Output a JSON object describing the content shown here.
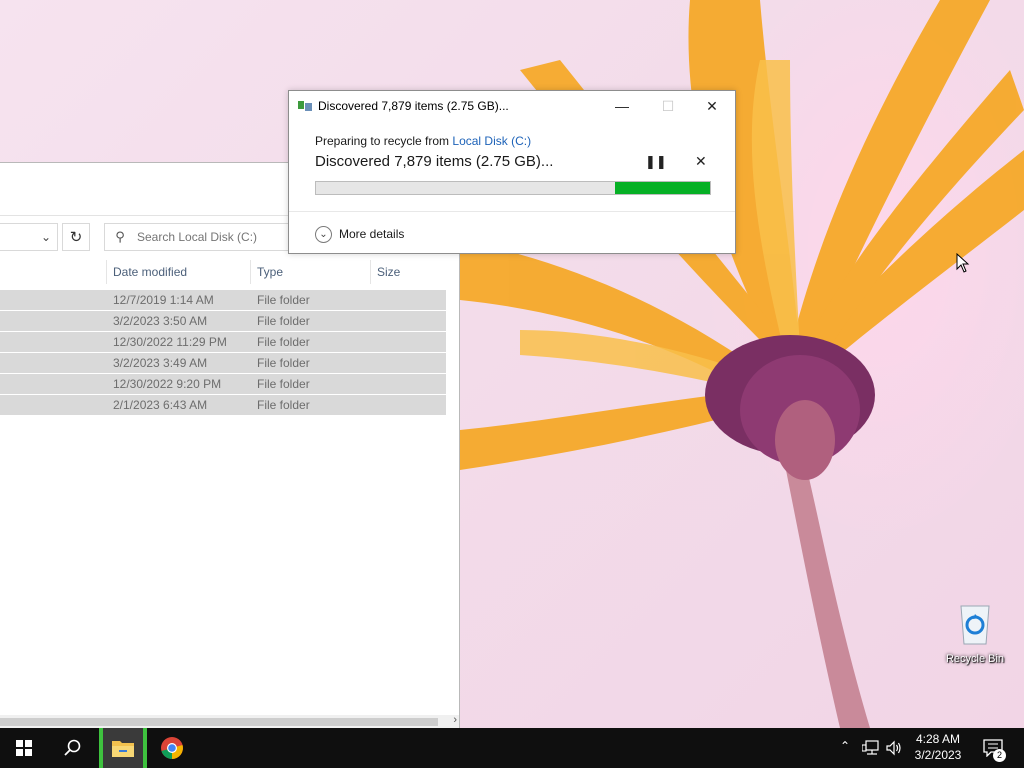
{
  "explorer": {
    "search_placeholder": "Search Local Disk (C:)",
    "columns": [
      "Date modified",
      "Type",
      "Size"
    ],
    "rows": [
      {
        "date": "12/7/2019 1:14 AM",
        "type": "File folder"
      },
      {
        "date": "3/2/2023 3:50 AM",
        "type": "File folder"
      },
      {
        "date": "12/30/2022 11:29 PM",
        "type": "File folder"
      },
      {
        "date": "3/2/2023 3:49 AM",
        "type": "File folder"
      },
      {
        "date": "12/30/2022 9:20 PM",
        "type": "File folder"
      },
      {
        "date": "2/1/2023 6:43 AM",
        "type": "File folder"
      }
    ]
  },
  "dialog": {
    "title": "Discovered 7,879 items (2.75 GB)...",
    "line1_prefix": "Preparing to recycle from ",
    "line1_link": "Local Disk (C:)",
    "status": "Discovered 7,879 items (2.75 GB)...",
    "progress_fraction": 0.24,
    "more_details": "More details",
    "accent_color": "#06b025"
  },
  "desktop": {
    "recycle_bin_label": "Recycle Bin"
  },
  "taskbar": {
    "time": "4:28 AM",
    "date": "3/2/2023",
    "notification_count": "2"
  }
}
